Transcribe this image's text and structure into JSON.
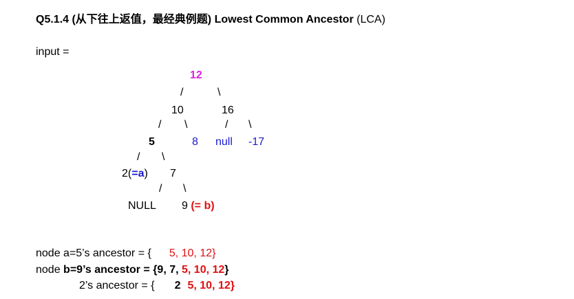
{
  "title": {
    "prefix": "Q5.1.4 (从下往上返值，最经典例题) Lowest Common Ancestor",
    "suffix": " (LCA)"
  },
  "input_label": "input =",
  "tree": {
    "root": "12",
    "l1_left": "10",
    "l1_right": "16",
    "l2_a": "5",
    "l2_b": "8",
    "l2_c": "null",
    "l2_d": "-17",
    "l3_left_num": "2(",
    "l3_left_tag": "=a",
    "l3_left_close": ")",
    "l3_right": "7",
    "l4_left": "NULL",
    "l4_right_num": "9 ",
    "l4_right_tag": "(= b)",
    "slash": "/",
    "backslash": "\\"
  },
  "ancestors": {
    "line1_label": "node a=5’s ancestor = {",
    "line1_values": "5, 10, 12}",
    "line2_label": "node ",
    "line2_bold": "b=9’s ancestor = {9, 7, ",
    "line2_values": "5, 10, 12",
    "line2_close": "}",
    "line3_label": "2’s ancestor = {",
    "line3_two": "2",
    "line3_values": "5, 10, 12}"
  },
  "colors": {
    "root": "#e020e0",
    "accent_blue": "#1a1acc",
    "accent_red": "#e01010"
  }
}
